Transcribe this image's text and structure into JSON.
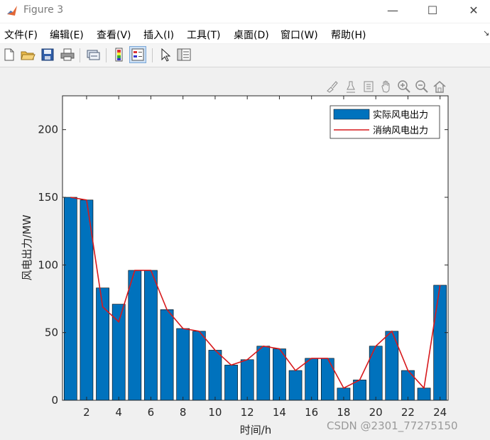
{
  "window": {
    "title": "Figure 3",
    "controls": [
      "—",
      "☐",
      "✕"
    ]
  },
  "menu": [
    "文件(F)",
    "编辑(E)",
    "查看(V)",
    "插入(I)",
    "工具(T)",
    "桌面(D)",
    "窗口(W)",
    "帮助(H)"
  ],
  "menu_pin": "↘",
  "toolbar": {
    "buttons": [
      "new-figure-icon",
      "open-file-icon",
      "save-icon",
      "print-icon",
      "link-plot-icon",
      "colorbar-icon",
      "legend-icon",
      "edit-pointer-icon",
      "property-inspector-icon"
    ]
  },
  "axes_toolbar": [
    "brush-icon",
    "data-tips-icon",
    "pan-icon",
    "zoom-in-icon",
    "zoom-out-icon",
    "home-icon"
  ],
  "chart_data": {
    "type": "bar",
    "x": [
      1,
      2,
      3,
      4,
      5,
      6,
      7,
      8,
      9,
      10,
      11,
      12,
      13,
      14,
      15,
      16,
      17,
      18,
      19,
      20,
      21,
      22,
      23,
      24
    ],
    "series": [
      {
        "name": "实际风电出力",
        "kind": "bar",
        "color": "#0072bd",
        "values": [
          150,
          148,
          83,
          71,
          96,
          96,
          67,
          53,
          51,
          37,
          26,
          30,
          40,
          38,
          22,
          31,
          31,
          9,
          15,
          40,
          51,
          22,
          9,
          85
        ]
      },
      {
        "name": "消纳风电出力",
        "kind": "line",
        "color": "#d95319",
        "values": [
          150,
          148,
          69,
          58,
          96,
          96,
          67,
          53,
          51,
          37,
          26,
          30,
          40,
          38,
          22,
          31,
          31,
          9,
          15,
          40,
          51,
          22,
          9,
          85
        ]
      }
    ],
    "xlabel": "时间/h",
    "ylabel": "风电出力/MW",
    "xlim": [
      0.5,
      24.5
    ],
    "ylim": [
      0,
      225
    ],
    "xticks": [
      2,
      4,
      6,
      8,
      10,
      12,
      14,
      16,
      18,
      20,
      22,
      24
    ],
    "yticks": [
      0,
      50,
      100,
      150,
      200
    ],
    "legend_position": "top-right",
    "grid": false
  },
  "watermark": "CSDN @2301_77275150"
}
